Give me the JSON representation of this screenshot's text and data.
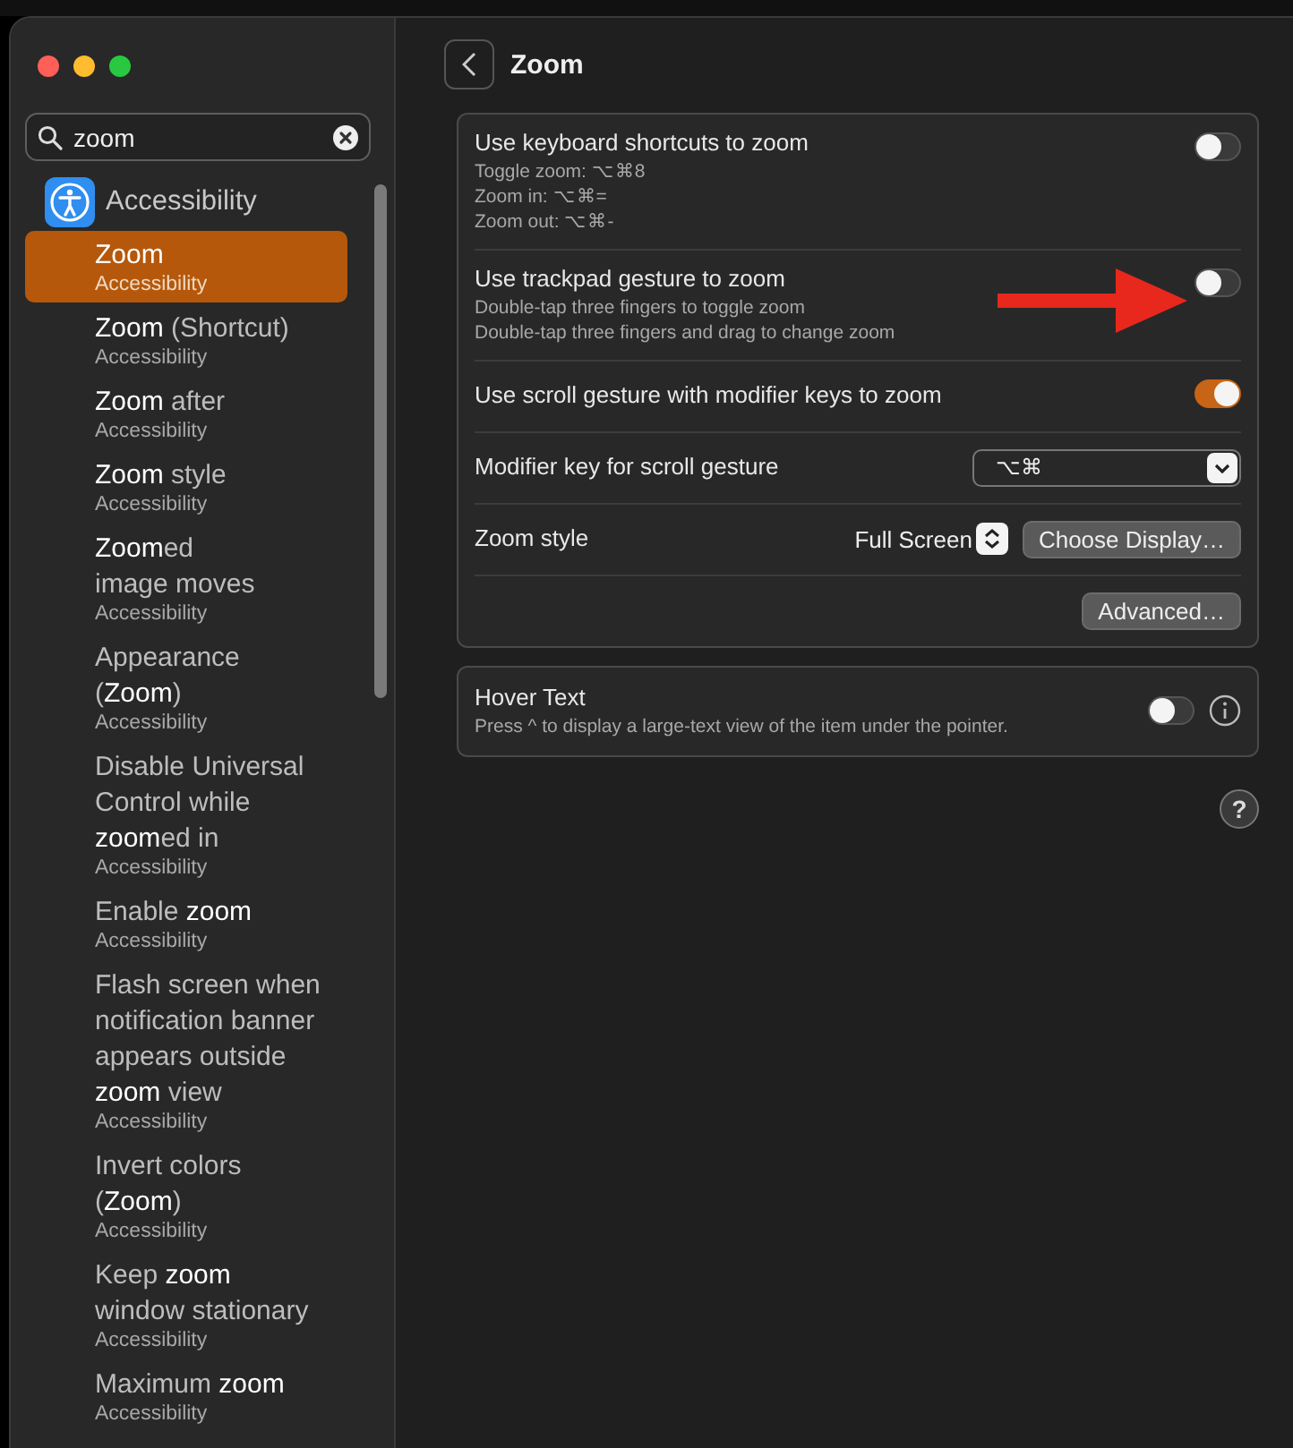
{
  "window": {
    "title": "Zoom"
  },
  "search": {
    "value": "zoom"
  },
  "sidebar": {
    "section": "Accessibility",
    "items": [
      {
        "title": "**Zoom**",
        "subtitle": "Accessibility",
        "selected": true
      },
      {
        "title": "**Zoom** (Shortcut)",
        "subtitle": "Accessibility",
        "selected": false
      },
      {
        "title": "**Zoom** after",
        "subtitle": "Accessibility",
        "selected": false
      },
      {
        "title": "**Zoom** style",
        "subtitle": "Accessibility",
        "selected": false
      },
      {
        "title": "**Zoom**ed\nimage moves",
        "subtitle": "Accessibility",
        "selected": false
      },
      {
        "title": "Appearance\n(**Zoom**)",
        "subtitle": "Accessibility",
        "selected": false
      },
      {
        "title": "Disable Universal\nControl while\n**zoom**ed in",
        "subtitle": "Accessibility",
        "selected": false
      },
      {
        "title": "Enable **zoom**",
        "subtitle": "Accessibility",
        "selected": false
      },
      {
        "title": "Flash screen when\nnotification banner\nappears outside\n**zoom** view",
        "subtitle": "Accessibility",
        "selected": false
      },
      {
        "title": "Invert colors\n(**Zoom**)",
        "subtitle": "Accessibility",
        "selected": false
      },
      {
        "title": "Keep **zoom**\nwindow stationary",
        "subtitle": "Accessibility",
        "selected": false
      },
      {
        "title": "Maximum **zoom**",
        "subtitle": "Accessibility",
        "selected": false
      }
    ]
  },
  "settings": [
    {
      "kind": "toggle",
      "label": "Use keyboard shortcuts to zoom",
      "notes": [
        "Toggle zoom: ⌥⌘8",
        "Zoom in: ⌥⌘=",
        "Zoom out: ⌥⌘-"
      ],
      "on": false,
      "highlighted": false
    },
    {
      "kind": "toggle",
      "label": "Use trackpad gesture to zoom",
      "notes": [
        "Double-tap three fingers to toggle zoom",
        "Double-tap three fingers and drag to change zoom"
      ],
      "on": false,
      "highlighted": true
    },
    {
      "kind": "toggle",
      "label": "Use scroll gesture with modifier keys to zoom",
      "on": true,
      "highlighted": false
    },
    {
      "kind": "select",
      "label": "Modifier key for scroll gesture",
      "value": "⌥⌘"
    },
    {
      "kind": "style",
      "label": "Zoom style",
      "value": "Full Screen",
      "button": "Choose Display…"
    },
    {
      "kind": "button",
      "button": "Advanced…"
    }
  ],
  "hover_text": {
    "label": "Hover Text",
    "note": "Press ^ to display a large-text view of the item under the pointer.",
    "on": false
  },
  "help": "?"
}
